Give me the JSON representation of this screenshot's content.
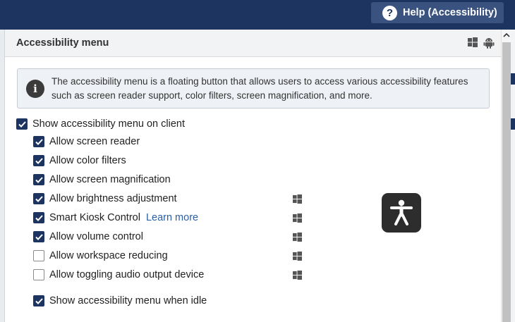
{
  "topbar": {
    "help_label": "Help (Accessibility)",
    "help_icon": "question-circle-icon"
  },
  "panel": {
    "title": "Accessibility menu",
    "platform_icons": [
      "windows-icon",
      "android-icon"
    ]
  },
  "info": {
    "icon": "info-icon",
    "text": "The accessibility menu is a floating button that allows users to access various accessibility features such as screen reader support, color filters, screen magnification, and more."
  },
  "settings": {
    "main": {
      "label": "Show accessibility menu on client",
      "checked": true
    },
    "options": [
      {
        "label": "Allow screen reader",
        "checked": true,
        "windows_only": false
      },
      {
        "label": "Allow color filters",
        "checked": true,
        "windows_only": false
      },
      {
        "label": "Allow screen magnification",
        "checked": true,
        "windows_only": false
      },
      {
        "label": "Allow brightness adjustment",
        "checked": true,
        "windows_only": true
      },
      {
        "label": "Smart Kiosk Control",
        "checked": true,
        "windows_only": true,
        "link": "Learn more"
      },
      {
        "label": "Allow volume control",
        "checked": true,
        "windows_only": true
      },
      {
        "label": "Allow workspace reducing",
        "checked": false,
        "windows_only": true
      },
      {
        "label": "Allow toggling audio output device",
        "checked": false,
        "windows_only": true
      }
    ],
    "idle": {
      "label": "Show accessibility menu when idle",
      "checked": true
    }
  },
  "preview": {
    "icon": "accessibility-person-icon"
  },
  "colors": {
    "navy": "#1d3461",
    "link": "#2a5fa8",
    "preview_bg": "#2d2d2d"
  }
}
